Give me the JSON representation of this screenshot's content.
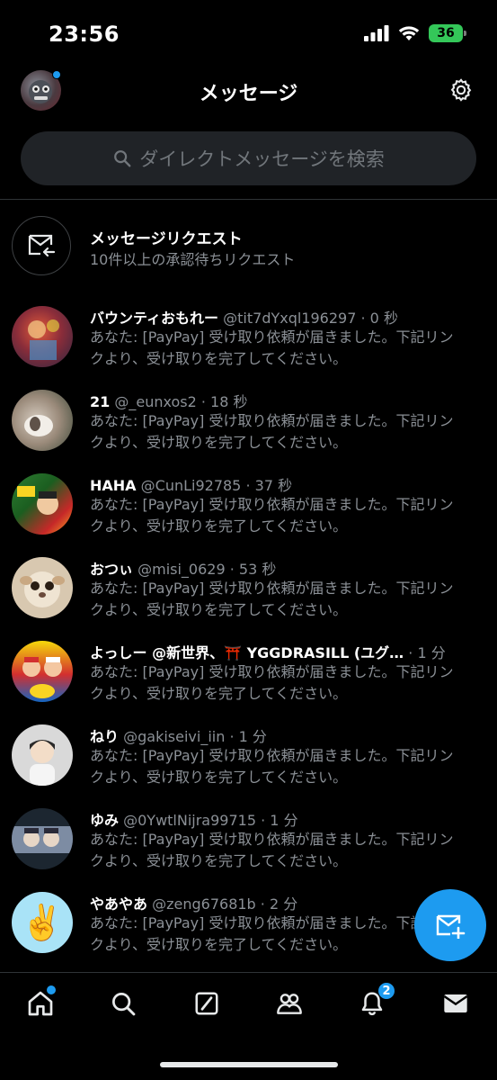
{
  "status": {
    "time": "23:56",
    "battery": "36"
  },
  "header": {
    "title": "メッセージ"
  },
  "search": {
    "placeholder": "ダイレクトメッセージを検索"
  },
  "request": {
    "title": "メッセージリクエスト",
    "subtitle": "10件以上の承認待ちリクエスト"
  },
  "conversations": [
    {
      "name": "バウンティおもれー",
      "handle": "@tit7dYxql196297",
      "time": "0 秒",
      "preview": "あなた: [PayPay] 受け取り依頼が届きました。下記リンクより、受け取りを完了してください。"
    },
    {
      "name": "21",
      "handle": "@_eunxos2",
      "time": "18 秒",
      "preview": "あなた: [PayPay] 受け取り依頼が届きました。下記リンクより、受け取りを完了してください。"
    },
    {
      "name": "HAHA",
      "handle": "@CunLi92785",
      "time": "37 秒",
      "preview": "あなた: [PayPay] 受け取り依頼が届きました。下記リンクより、受け取りを完了してください。"
    },
    {
      "name": "おつぃ",
      "handle": "@misi_0629",
      "time": "53 秒",
      "preview": "あなた: [PayPay] 受け取り依頼が届きました。下記リンクより、受け取りを完了してください。"
    },
    {
      "name": "よっしー @新世界、⛩️ YGGDRASILL (ユグ…",
      "handle": "",
      "time": "1 分",
      "preview": "あなた: [PayPay] 受け取り依頼が届きました。下記リンクより、受け取りを完了してください。"
    },
    {
      "name": "ねり",
      "handle": "@gakiseivi_iin",
      "time": "1 分",
      "preview": "あなた: [PayPay] 受け取り依頼が届きました。下記リンクより、受け取りを完了してください。"
    },
    {
      "name": "ゆみ",
      "handle": "@0YwtlNijra99715",
      "time": "1 分",
      "preview": "あなた: [PayPay] 受け取り依頼が届きました。下記リンクより、受け取りを完了してください。"
    },
    {
      "name": "やあやあ",
      "handle": "@zeng67681b",
      "time": "2 分",
      "preview": "あなた: [PayPay] 受け取り依頼が届きました。下記リンクより、受け取りを完了してください。"
    }
  ],
  "nav": {
    "notifications_badge": "2"
  },
  "avatars": {
    "colors": [
      "#8b2d3a",
      "#9a8a7a",
      "#2e7d32",
      "#d8c8b0",
      "#d32f2f",
      "#cfcfcf",
      "#5a6b8a",
      "#a9e3f7"
    ],
    "emoji_last": "✌️"
  },
  "accent": "#1d9bf0"
}
